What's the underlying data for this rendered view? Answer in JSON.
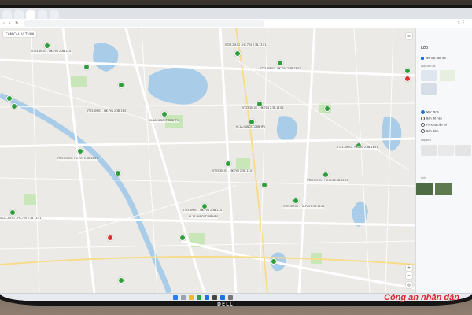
{
  "browser": {
    "tabs": [
      "",
      "",
      "",
      "",
      ""
    ],
    "address": "",
    "map_title": "CAM CAU VI TUAN",
    "zoom_in_icon": "plus-icon",
    "zoom_out_icon": "minus-icon"
  },
  "panel": {
    "title": "Lớp",
    "layer_checkbox": "Tên lớp bản đồ",
    "radio_items": [
      "Mặc định",
      "Bản đồ nền",
      "Phương tiện số",
      "Bảo đảm"
    ],
    "section_label_1": "Loại bản đồ",
    "section_label_2": "Lớp phủ",
    "section_label_3": "Ảnh"
  },
  "markers": {
    "label_sample": "VT23.2M.01 - HK.7V4 2.3B.13.01",
    "label_sub": "HL1A-HANOI-T-D8NHP4"
  },
  "taskbar": {
    "time": "",
    "monitor_brand": "DELL"
  },
  "watermark": "Công an nhân dân",
  "colors": {
    "marker": "#2e9e3a",
    "marker_alert": "#e03030",
    "water": "#a9cde9",
    "park": "#c8e6b8",
    "accent": "#1a73e8",
    "watermark": "#d8262e"
  }
}
